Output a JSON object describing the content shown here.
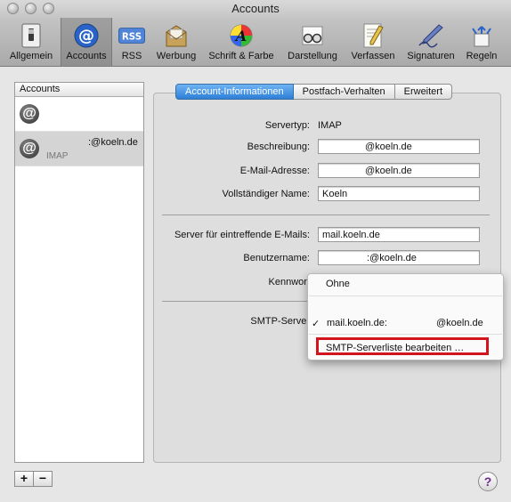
{
  "window": {
    "title": "Accounts"
  },
  "toolbar": {
    "items": [
      {
        "label": "Allgemein",
        "icon": "switch-icon"
      },
      {
        "label": "Accounts",
        "icon": "at-icon"
      },
      {
        "label": "RSS",
        "icon": "rss-icon"
      },
      {
        "label": "Werbung",
        "icon": "junk-mail-icon"
      },
      {
        "label": "Schrift & Farbe",
        "icon": "font-color-icon"
      },
      {
        "label": "Darstellung",
        "icon": "glasses-icon"
      },
      {
        "label": "Verfassen",
        "icon": "compose-icon"
      },
      {
        "label": "Signaturen",
        "icon": "signature-icon"
      },
      {
        "label": "Regeln",
        "icon": "rules-icon"
      }
    ],
    "selected": "Accounts"
  },
  "sidebar": {
    "header": "Accounts",
    "accounts": [
      {
        "name": "",
        "type": ""
      },
      {
        "name": ":@koeln.de",
        "type": "IMAP"
      }
    ],
    "add_label": "+",
    "remove_label": "−"
  },
  "tabs": [
    {
      "label": "Account-Informationen",
      "active": true
    },
    {
      "label": "Postfach-Verhalten",
      "active": false
    },
    {
      "label": "Erweitert",
      "active": false
    }
  ],
  "form": {
    "servertyp_label": "Servertyp:",
    "servertyp_value": "IMAP",
    "beschreibung_label": "Beschreibung:",
    "beschreibung_value": "@koeln.de",
    "email_label": "E-Mail-Adresse:",
    "email_value": "@koeln.de",
    "name_label": "Vollständiger Name:",
    "name_value": "Koeln",
    "incoming_label": "Server für eintreffende E-Mails:",
    "incoming_value": "mail.koeln.de",
    "user_label": "Benutzername:",
    "user_value": ":@koeln.de",
    "password_label": "Kennwort",
    "smtp_label": "SMTP-Server"
  },
  "smtp_menu": {
    "items": [
      {
        "label": "Ohne",
        "checked": false
      },
      {
        "label": "mail.koeln.de:",
        "extra": "@koeln.de",
        "checked": true
      },
      {
        "label": "SMTP-Serverliste bearbeiten …",
        "checked": false
      }
    ],
    "check_mark": "✓"
  },
  "help": {
    "label": "?"
  },
  "colors": {
    "tab_active": "#2d7fd7",
    "highlight": "#d2141e"
  }
}
